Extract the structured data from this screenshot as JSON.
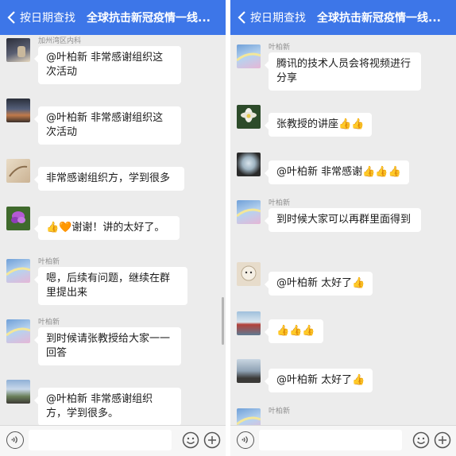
{
  "left": {
    "header": {
      "back_label": "按日期查找",
      "title": "全球抗击新冠疫情一线..."
    },
    "messages": [
      {
        "sender": "加州湾区内科",
        "text": "@叶柏新 非常感谢组织这次活动"
      },
      {
        "sender": "",
        "text": "@叶柏新 非常感谢组织这次活动"
      },
      {
        "sender": "",
        "text": "非常感谢组织方，学到很多"
      },
      {
        "sender": "",
        "text": "👍🧡谢谢！讲的太好了。"
      },
      {
        "sender": "叶柏新",
        "text": "嗯，后续有问题，继续在群里提出来"
      },
      {
        "sender": "叶柏新",
        "text": "到时候请张教授给大家一一回答"
      },
      {
        "sender": "",
        "text": "@叶柏新 非常感谢组织方，学到很多。"
      }
    ]
  },
  "right": {
    "header": {
      "back_label": "按日期查找",
      "title": "全球抗击新冠疫情一线..."
    },
    "messages": [
      {
        "sender": "叶柏新",
        "text": "腾讯的技术人员会将视频进行分享"
      },
      {
        "sender": "",
        "text": "张教授的讲座👍👍"
      },
      {
        "sender": "",
        "text": "@叶柏新 非常感谢👍👍👍"
      },
      {
        "sender": "叶柏新",
        "text": "到时候大家可以再群里面得到"
      },
      {
        "sender": "",
        "text": "@叶柏新 太好了👍"
      },
      {
        "sender": "",
        "text": "👍👍👍"
      },
      {
        "sender": "",
        "text": "@叶柏新 太好了👍"
      },
      {
        "sender": "叶柏新",
        "text": ""
      }
    ]
  },
  "colors": {
    "header_blue": "#3d76e8",
    "chat_bg": "#ececec",
    "bubble": "#ffffff"
  },
  "icons": [
    "back-arrow-icon",
    "voice-icon",
    "emoji-icon",
    "plus-icon"
  ]
}
